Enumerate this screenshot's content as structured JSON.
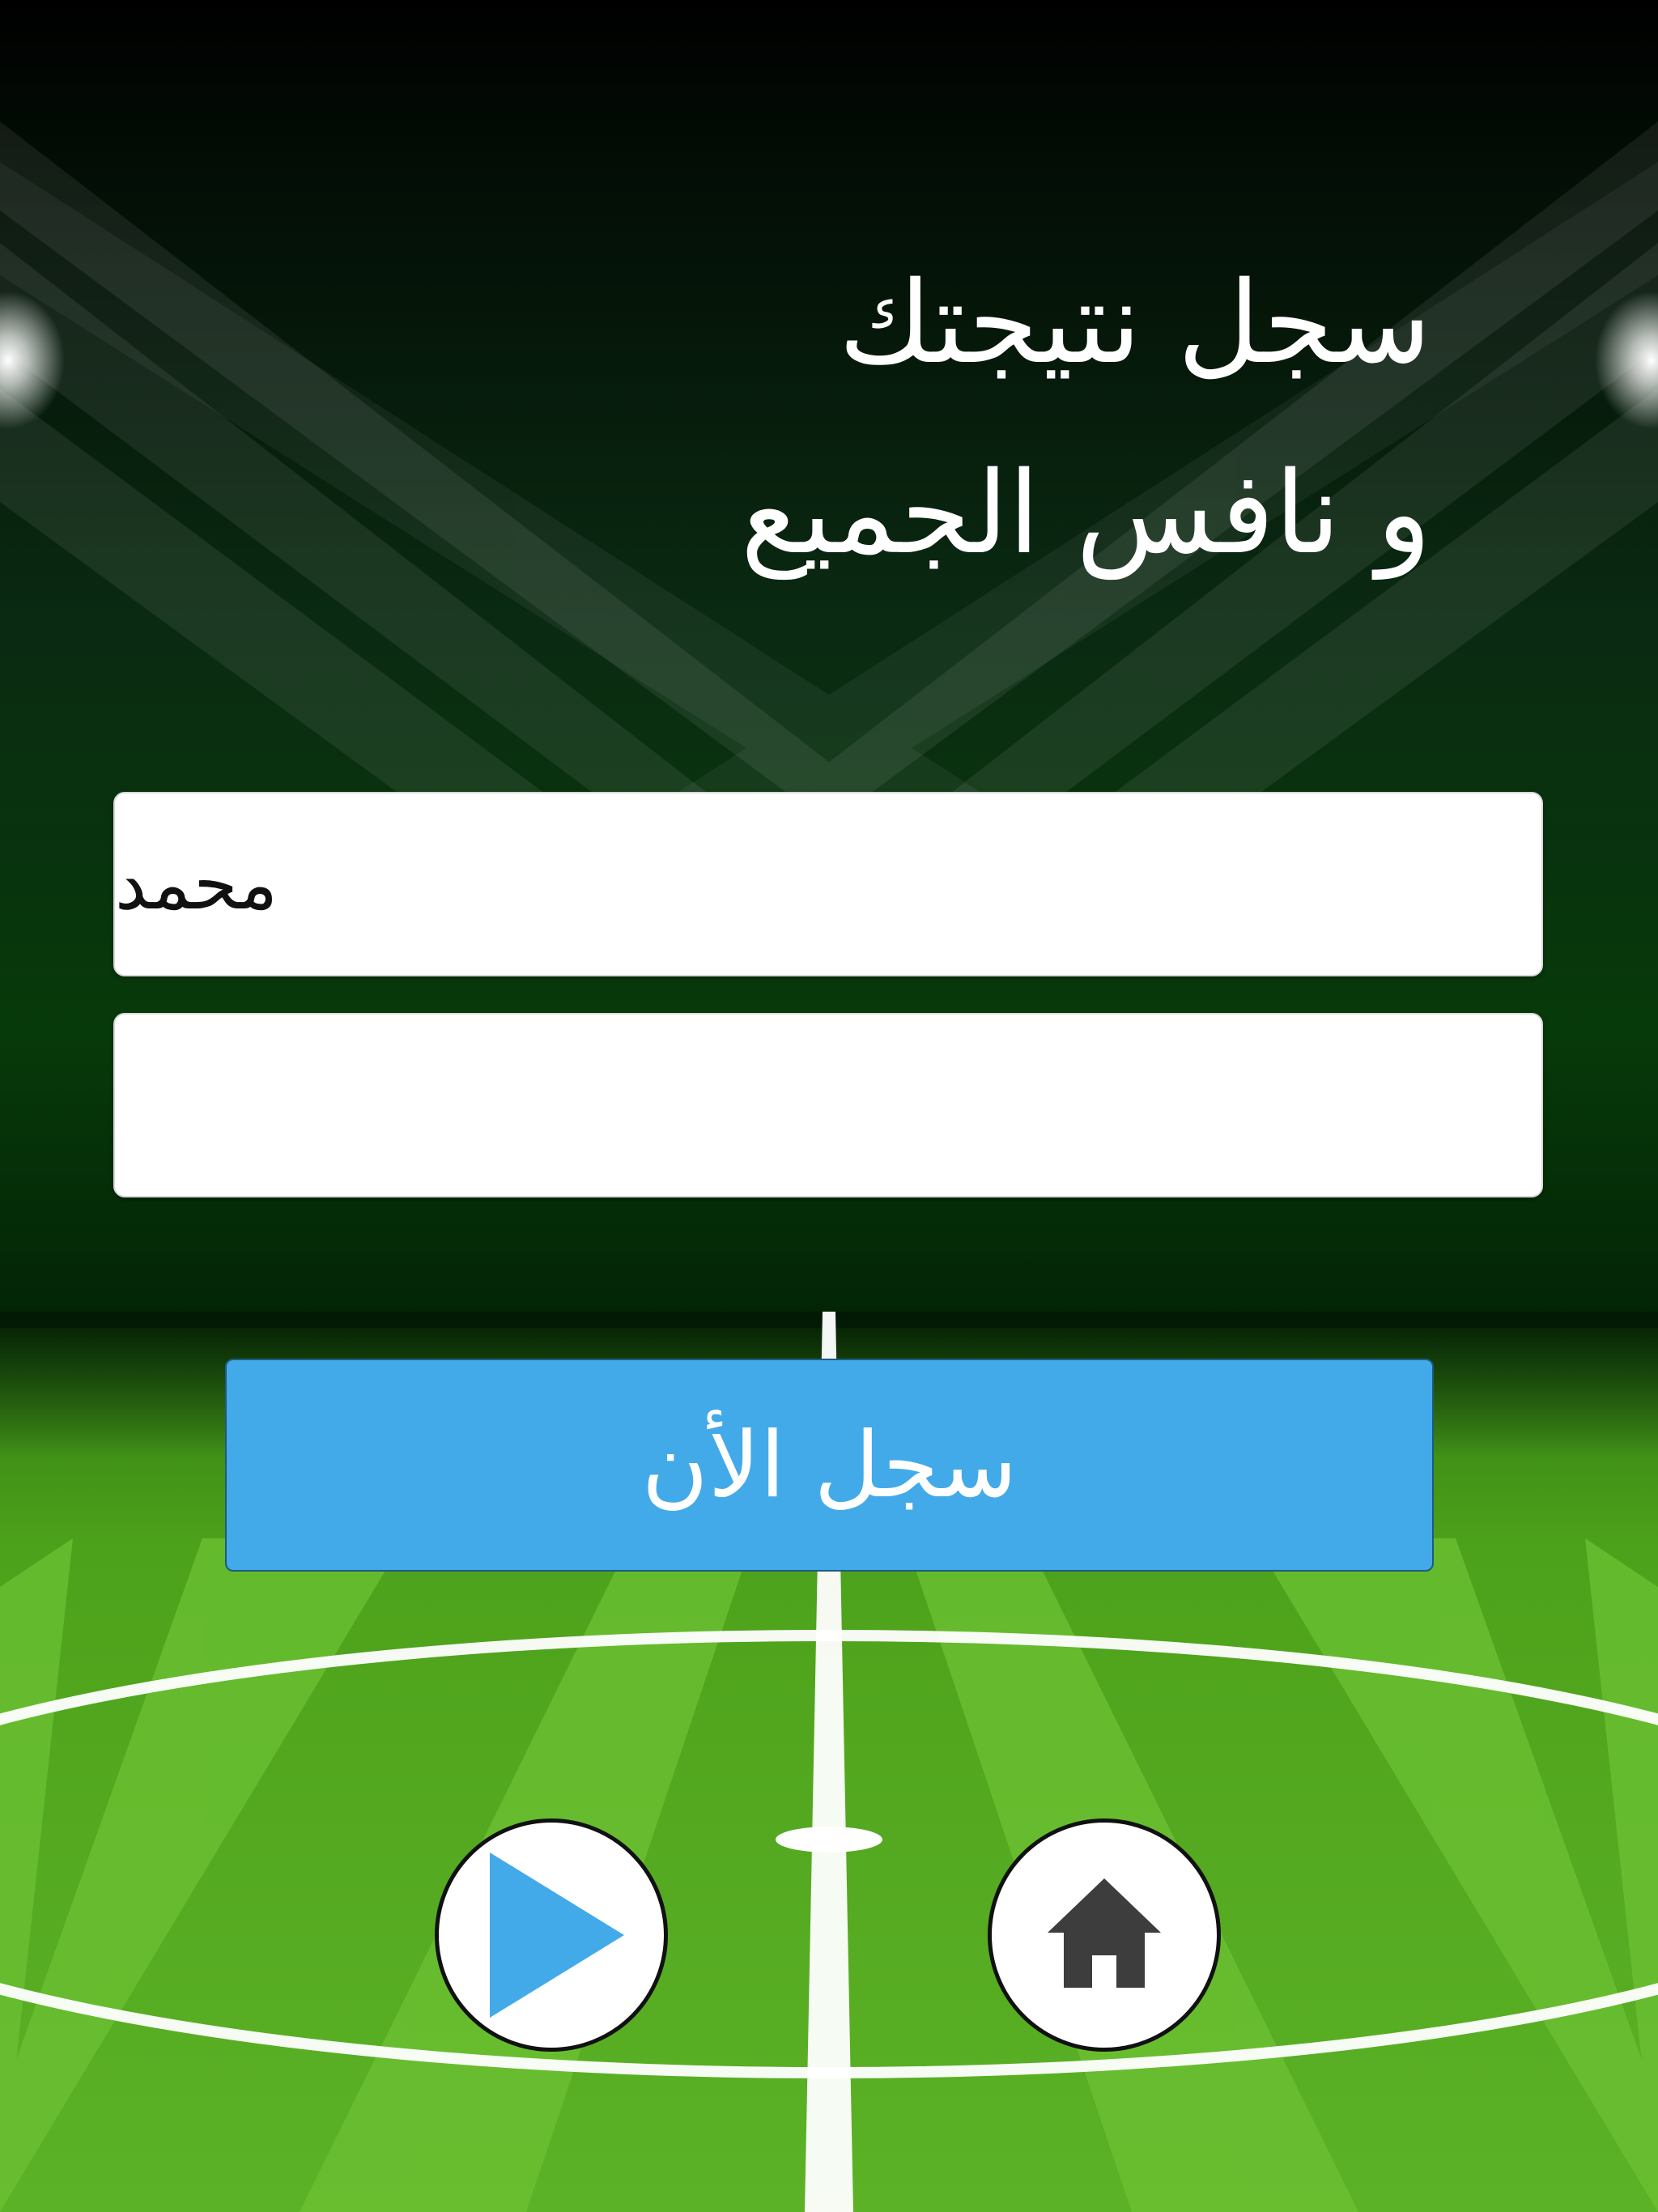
{
  "headline": {
    "line1": "سجل نتيجتك",
    "line2": "و نافس الجميع"
  },
  "form": {
    "name_field_value": "محمد",
    "second_field_value": ""
  },
  "register_button": {
    "label": "سجل الأن"
  },
  "nav": {
    "play_icon": "play-icon",
    "home_icon": "home-icon"
  },
  "colors": {
    "button_blue": "#43aae9",
    "pitch_green_dark": "#4a9e1a",
    "pitch_green_light": "#6abf30",
    "home_icon_gray": "#3d3d3d"
  }
}
